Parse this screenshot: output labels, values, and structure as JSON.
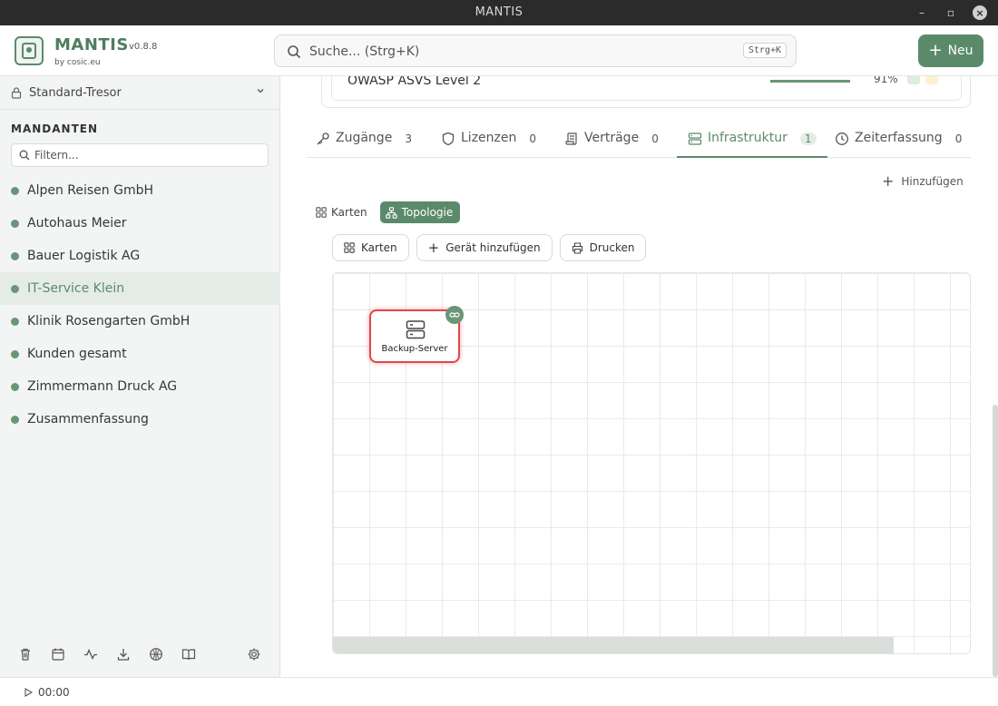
{
  "window": {
    "title": "MANTIS"
  },
  "header": {
    "brand": "MANTIS",
    "version": "v0.8.8",
    "byline": "by cosic.eu",
    "search_placeholder": "Suche... (Strg+K)",
    "search_shortcut": "Strg+K",
    "new_button": "Neu"
  },
  "sidebar": {
    "vault": "Standard-Tresor",
    "heading": "MANDANTEN",
    "filter_placeholder": "Filtern...",
    "clients": [
      {
        "label": "Alpen Reisen GmbH",
        "active": false
      },
      {
        "label": "Autohaus Meier",
        "active": false
      },
      {
        "label": "Bauer Logistik AG",
        "active": false
      },
      {
        "label": "IT-Service Klein",
        "active": true
      },
      {
        "label": "Klinik Rosengarten GmbH",
        "active": false
      },
      {
        "label": "Kunden gesamt",
        "active": false
      },
      {
        "label": "Zimmermann Druck AG",
        "active": false
      },
      {
        "label": "Zusammenfassung",
        "active": false
      }
    ],
    "footer_icons": [
      "trash-icon",
      "calendar-icon",
      "activity-icon",
      "download-icon",
      "globe-icon",
      "book-icon",
      "gear-icon"
    ]
  },
  "main": {
    "top_card": {
      "title": "OWASP ASVS Level 2",
      "percent": "91%"
    },
    "tabs": [
      {
        "label": "Zugänge",
        "count": "3",
        "icon": "key-icon"
      },
      {
        "label": "Lizenzen",
        "count": "0",
        "icon": "shield-icon"
      },
      {
        "label": "Verträge",
        "count": "0",
        "icon": "scroll-icon"
      },
      {
        "label": "Infrastruktur",
        "count": "1",
        "icon": "server-icon",
        "active": true
      },
      {
        "label": "Zeiterfassung",
        "count": "0",
        "icon": "clock-icon"
      }
    ],
    "add_link": "Hinzufügen",
    "view_toggle": {
      "cards": "Karten",
      "topology": "Topologie",
      "active": "topology"
    },
    "toolbar": {
      "cards": "Karten",
      "add_device": "Gerät hinzufügen",
      "print": "Drucken"
    },
    "topology_nodes": [
      {
        "label": "Backup-Server",
        "icon": "server-icon",
        "selected": true
      }
    ]
  },
  "statusbar": {
    "timer": "00:00"
  },
  "colors": {
    "accent": "#5b8a6b",
    "selected_node_border": "#e04848"
  }
}
